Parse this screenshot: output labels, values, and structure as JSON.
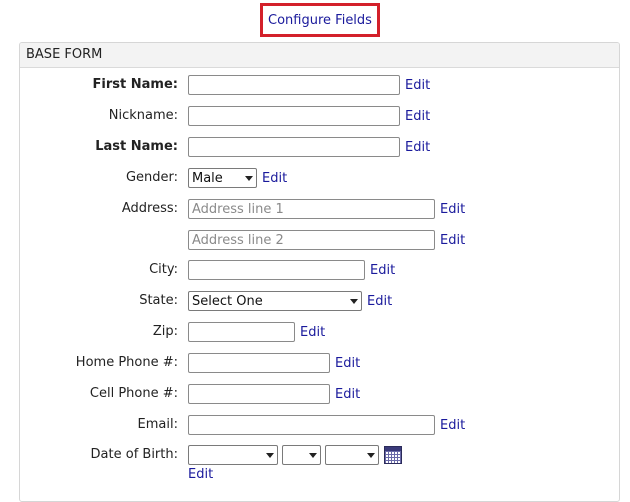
{
  "configure_fields": "Configure Fields",
  "panel": {
    "title": "BASE FORM"
  },
  "edit_label": "Edit",
  "fields": {
    "first_name": {
      "label": "First Name:",
      "value": ""
    },
    "nickname": {
      "label": "Nickname:",
      "value": ""
    },
    "last_name": {
      "label": "Last Name:",
      "value": ""
    },
    "gender": {
      "label": "Gender:",
      "selected": "Male"
    },
    "address": {
      "label": "Address:",
      "line1_placeholder": "Address line 1",
      "line2_placeholder": "Address line 2"
    },
    "city": {
      "label": "City:",
      "value": ""
    },
    "state": {
      "label": "State:",
      "selected": "Select One"
    },
    "zip": {
      "label": "Zip:",
      "value": ""
    },
    "home_phone": {
      "label": "Home Phone #:",
      "value": ""
    },
    "cell_phone": {
      "label": "Cell Phone #:",
      "value": ""
    },
    "email": {
      "label": "Email:",
      "value": ""
    },
    "dob": {
      "label": "Date of Birth:",
      "month": "",
      "day": "",
      "year": ""
    }
  },
  "icons": {
    "calendar": "calendar-icon",
    "dropdown": "chevron-down-icon"
  }
}
